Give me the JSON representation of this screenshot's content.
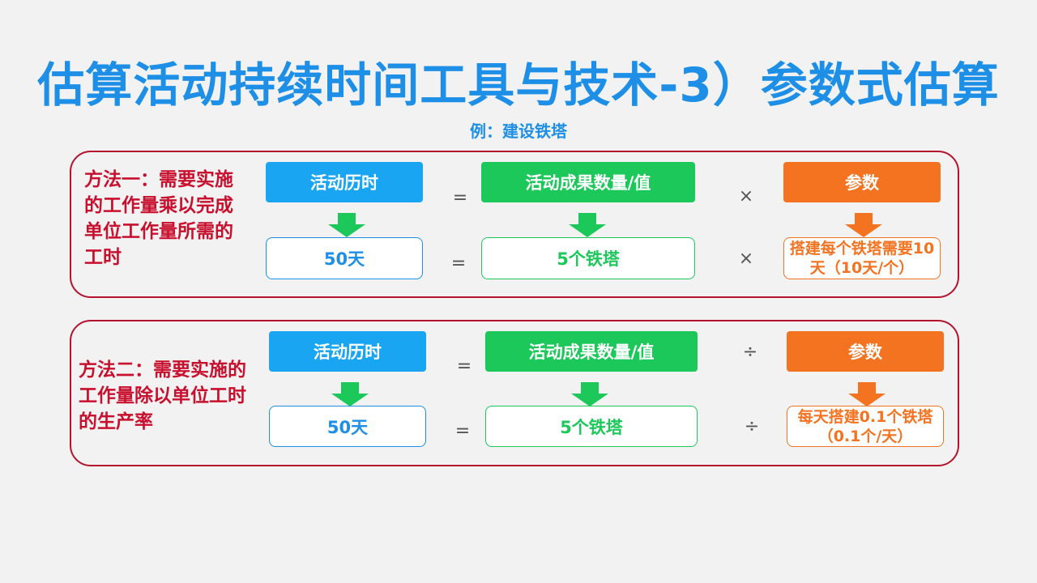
{
  "title": "估算活动持续时间工具与技术-3）参数式估算",
  "subtitle": "例：建设铁塔",
  "colors": {
    "title_blue": "#1e8fe6",
    "panel_border": "#b5122e",
    "method_red": "#c8102e",
    "blue": "#1aa5f2",
    "green": "#1cc85a",
    "orange": "#f47321"
  },
  "method1": {
    "text": "方法一：需要实施的工作量乘以完成单位工作量所需的工时",
    "header": {
      "duration": "活动历时",
      "eq": "=",
      "quantity": "活动成果数量/值",
      "op": "×",
      "param": "参数"
    },
    "values": {
      "duration": "50天",
      "eq": "=",
      "quantity": "5个铁塔",
      "op": "×",
      "param": "搭建每个铁塔需要10天（10天/个）"
    },
    "arrow_icon": "green-down-arrow-icon"
  },
  "method2": {
    "text": "方法二：需要实施的工作量除以单位工时的生产率",
    "header": {
      "duration": "活动历时",
      "eq": "=",
      "quantity": "活动成果数量/值",
      "op": "÷",
      "param": "参数"
    },
    "values": {
      "duration": "50天",
      "eq": "=",
      "quantity": "5个铁塔",
      "op": "÷",
      "param": "每天搭建0.1个铁塔（0.1个/天）"
    },
    "arrow_icon": "green-down-arrow-icon"
  }
}
